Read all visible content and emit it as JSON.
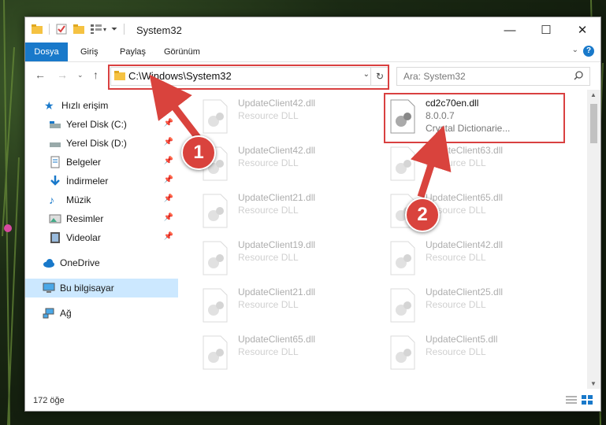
{
  "window": {
    "title": "System32",
    "close_label": "✕",
    "max_label": "☐",
    "min_label": "—"
  },
  "ribbon": {
    "tabs": [
      "Dosya",
      "Giriş",
      "Paylaş",
      "Görünüm"
    ],
    "help_label": "?"
  },
  "address": {
    "path": "C:\\Windows\\System32",
    "search_placeholder": "Ara: System32"
  },
  "sidebar": {
    "items": [
      {
        "label": "Hızlı erişim",
        "icon": "star-icon",
        "pinned": false
      },
      {
        "label": "Yerel Disk (C:)",
        "icon": "drive-icon",
        "pinned": true
      },
      {
        "label": "Yerel Disk (D:)",
        "icon": "drive-icon",
        "pinned": true
      },
      {
        "label": "Belgeler",
        "icon": "document-icon",
        "pinned": true
      },
      {
        "label": "İndirmeler",
        "icon": "download-icon",
        "pinned": true
      },
      {
        "label": "Müzik",
        "icon": "music-icon",
        "pinned": true
      },
      {
        "label": "Resimler",
        "icon": "pictures-icon",
        "pinned": true
      },
      {
        "label": "Videolar",
        "icon": "video-icon",
        "pinned": true
      },
      {
        "label": "OneDrive",
        "icon": "cloud-icon",
        "pinned": false
      },
      {
        "label": "Bu bilgisayar",
        "icon": "computer-icon",
        "pinned": false
      },
      {
        "label": "Ağ",
        "icon": "network-icon",
        "pinned": false
      }
    ],
    "selected": "Bu bilgisayar"
  },
  "files": {
    "left_column": [
      {
        "name": "UpdateClient42.dll",
        "sub": "Resource DLL"
      },
      {
        "name": "UpdateClient42.dll",
        "sub": "Resource DLL"
      },
      {
        "name": "UpdateClient21.dll",
        "sub": "Resource DLL"
      },
      {
        "name": "UpdateClient19.dll",
        "sub": "Resource DLL"
      },
      {
        "name": "UpdateClient21.dll",
        "sub": "Resource DLL"
      },
      {
        "name": "UpdateClient65.dll",
        "sub": "Resource DLL"
      }
    ],
    "highlighted": {
      "name": "cd2c70en.dll",
      "version": "8.0.0.7",
      "description": "Crystal Dictionarie..."
    },
    "right_column": [
      {
        "name": "UpdateClient63.dll",
        "sub": "Resource DLL"
      },
      {
        "name": "UpdateClient65.dll",
        "sub": "Resource DLL"
      },
      {
        "name": "UpdateClient42.dll",
        "sub": "Resource DLL"
      },
      {
        "name": "UpdateClient25.dll",
        "sub": "Resource DLL"
      },
      {
        "name": "UpdateClient5.dll",
        "sub": "Resource DLL"
      }
    ]
  },
  "status": {
    "item_count": "172 öğe"
  },
  "annotations": {
    "badge1": "1",
    "badge2": "2",
    "color": "#d9433d"
  }
}
